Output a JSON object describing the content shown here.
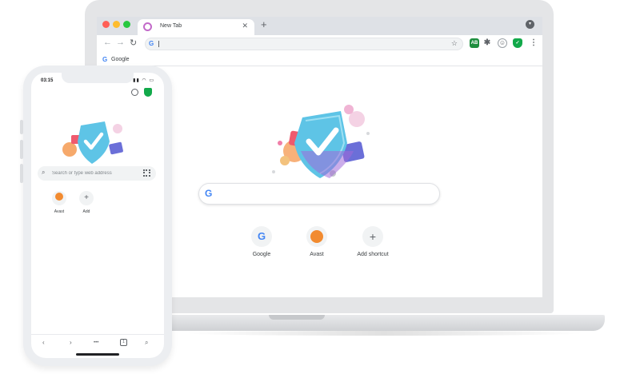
{
  "laptop": {
    "tab": {
      "title": "New Tab",
      "close_label": "✕",
      "favicon": "avast-secure-browser-icon"
    },
    "new_tab_label": "+",
    "toolbar": {
      "back_icon": "back-arrow-icon",
      "forward_icon": "forward-arrow-icon",
      "reload_icon": "reload-icon",
      "omnibox_value": "",
      "extensions": {
        "adblock_label": "AB",
        "puzzle_icon": "puzzle-icon",
        "profile_icon": "profile-icon",
        "shield_icon": "avast-shield-icon",
        "menu_icon": "kebab-menu-icon"
      }
    },
    "bookmarks": [
      {
        "label": "Google",
        "icon": "google-icon"
      }
    ],
    "search": {
      "placeholder": ""
    },
    "shortcuts": [
      {
        "label": "Google",
        "icon": "google-icon"
      },
      {
        "label": "Avast",
        "icon": "avast-icon"
      },
      {
        "label": "Add shortcut",
        "icon": "plus-icon"
      }
    ]
  },
  "phone": {
    "status_time": "03:15",
    "search_placeholder": "Search or type web address",
    "shortcuts": [
      {
        "label": "Avast",
        "icon": "avast-icon"
      },
      {
        "label": "Add",
        "icon": "plus-icon"
      }
    ],
    "bottom_nav": {
      "back_icon": "back-icon",
      "forward_icon": "forward-icon",
      "more_label": "•••",
      "tab_count": "1",
      "search_icon": "search-icon"
    }
  },
  "colors": {
    "chrome_frame": "#dee1e6",
    "shield_green": "#12a94a",
    "google_blue": "#4285f4",
    "avast_orange": "#f28b30",
    "hero_shield": "#5ec4e6"
  }
}
